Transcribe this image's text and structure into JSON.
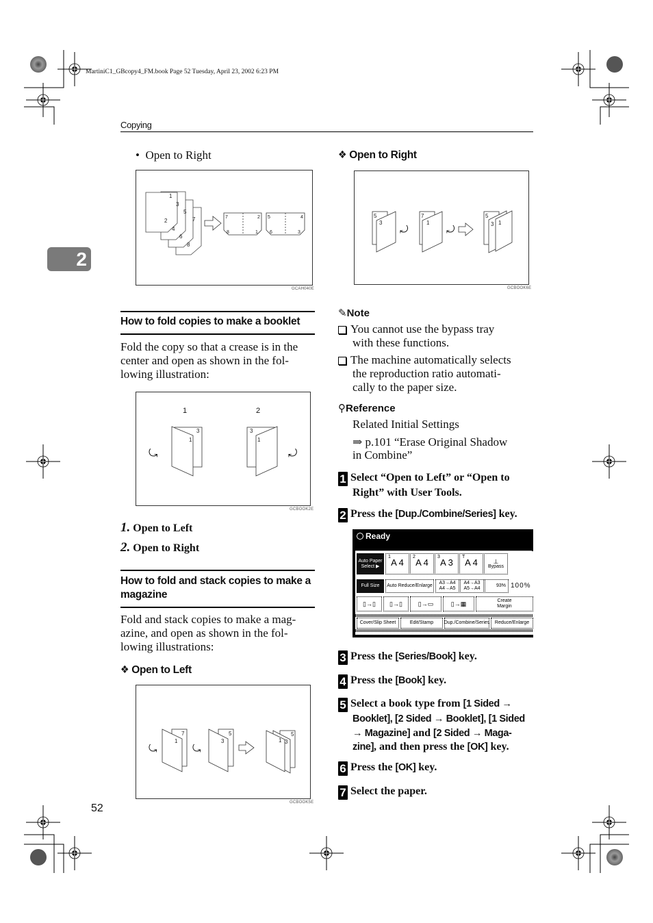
{
  "print_header": "MartiniC1_GBcopy4_FM.book  Page 52  Tuesday, April 23, 2002  6:23 PM",
  "section": "Copying",
  "chapter_tab": "2",
  "page_number": "52",
  "left_column": {
    "bullet_item": "Open to Right",
    "figure1": {
      "code": "GCAH040E",
      "stack_pages": [
        "1",
        "2",
        "3",
        "4",
        "5",
        "6",
        "7",
        "8"
      ],
      "result_left": {
        "tl": "7",
        "tr": "2",
        "bl": "8",
        "br": "1"
      },
      "result_right": {
        "tl": "5",
        "tr": "4",
        "bl": "6",
        "br": "3"
      }
    },
    "booklet_heading": "How to fold copies to make a booklet",
    "booklet_text": [
      "Fold the copy so that a crease is in the",
      "center and open as shown in the fol-",
      "lowing illustration:"
    ],
    "figure2": {
      "code": "GCBOOK2E",
      "label1": "1",
      "label2": "2",
      "page_front": "1",
      "page_back": "3"
    },
    "numbered": [
      {
        "num": "1.",
        "label": "Open to Left"
      },
      {
        "num": "2.",
        "label": "Open to Right"
      }
    ],
    "magazine_heading_lines": [
      "How to fold and stack copies to make a",
      "magazine"
    ],
    "magazine_text": [
      "Fold and stack copies to make a mag-",
      "azine, and open as shown in the fol-",
      "lowing illustrations:"
    ],
    "open_left_heading": "Open to Left",
    "figure3": {
      "code": "GCBOOK5E",
      "sheet1": {
        "front": "1",
        "back": "7"
      },
      "sheet2": {
        "front": "3",
        "back": "5"
      },
      "result": {
        "a": "1",
        "b": "3",
        "c": "5"
      }
    }
  },
  "right_column": {
    "open_right_heading": "Open to Right",
    "figure4": {
      "code": "GCBOOK6E",
      "sheet1": {
        "back": "5",
        "front": "3"
      },
      "sheet2": {
        "back": "7",
        "front": "1"
      },
      "result": {
        "a": "5",
        "b": "3",
        "c": "1"
      }
    },
    "note_title": "Note",
    "notes": [
      [
        "You cannot use the bypass tray",
        "with these functions."
      ],
      [
        "The machine automatically selects",
        "the reproduction ratio automati-",
        "cally to the paper size."
      ]
    ],
    "reference_title": "Reference",
    "reference_line1": "Related Initial Settings",
    "reference_line2": "⇒ p.101 “Erase Original Shadow",
    "reference_line3": "in Combine”",
    "steps": [
      {
        "num": "1",
        "parts": [
          {
            "t": "Select “Open to Left” or “Open to"
          },
          {
            "t": "Right” with User Tools."
          }
        ]
      },
      {
        "num": "2",
        "pre": "Press the ",
        "key": "[Dup./Combine/Series]",
        "post": " key."
      },
      {
        "num": "3",
        "pre": "Press the ",
        "key": "[Series/Book]",
        "post": " key."
      },
      {
        "num": "4",
        "pre": "Press the ",
        "key": "[Book]",
        "post": " key."
      },
      {
        "num": "5",
        "line1_pre": "Select a book type from ",
        "line1_key": "[1 Sided →",
        "line2_key": "Booklet], [2 Sided → Booklet], [1 Sided",
        "line3_key_a": "→ Magazine]",
        "line3_mid": " and ",
        "line3_key_b": "[2 Sided → Maga-",
        "line4_key": "zine]",
        "line4_mid": ", and then press the ",
        "line4_key2": "[OK]",
        "line4_post": " key."
      },
      {
        "num": "6",
        "pre": "Press the ",
        "key": "[OK]",
        "post": " key."
      },
      {
        "num": "7",
        "pre": "Select the paper.",
        "key": "",
        "post": ""
      }
    ],
    "panel": {
      "status": "Ready",
      "auto_paper": [
        "Auto Paper",
        "Select ▶"
      ],
      "trays": [
        {
          "tag": "1",
          "size": "A 4"
        },
        {
          "tag": "2",
          "size": "A 4"
        },
        {
          "tag": "3",
          "size": "A 3"
        },
        {
          "tag": "T",
          "size": "A 4"
        }
      ],
      "bypass": "Bypass",
      "full_size": "Full Size",
      "auto_reduce": "Auto Reduce/Enlarge",
      "ratio1": [
        "A3→A4",
        "A4→A5"
      ],
      "ratio2": [
        "A4→A3",
        "A5→A4"
      ],
      "ratio3": "93%",
      "ratio_display": "100%",
      "create_margin": [
        "Create",
        "Margin"
      ],
      "tabs": [
        "Cover/Slip Sheet",
        "Edit/Stamp",
        "Dup./Combine/Series",
        "Reduce/Enlarge"
      ]
    }
  }
}
